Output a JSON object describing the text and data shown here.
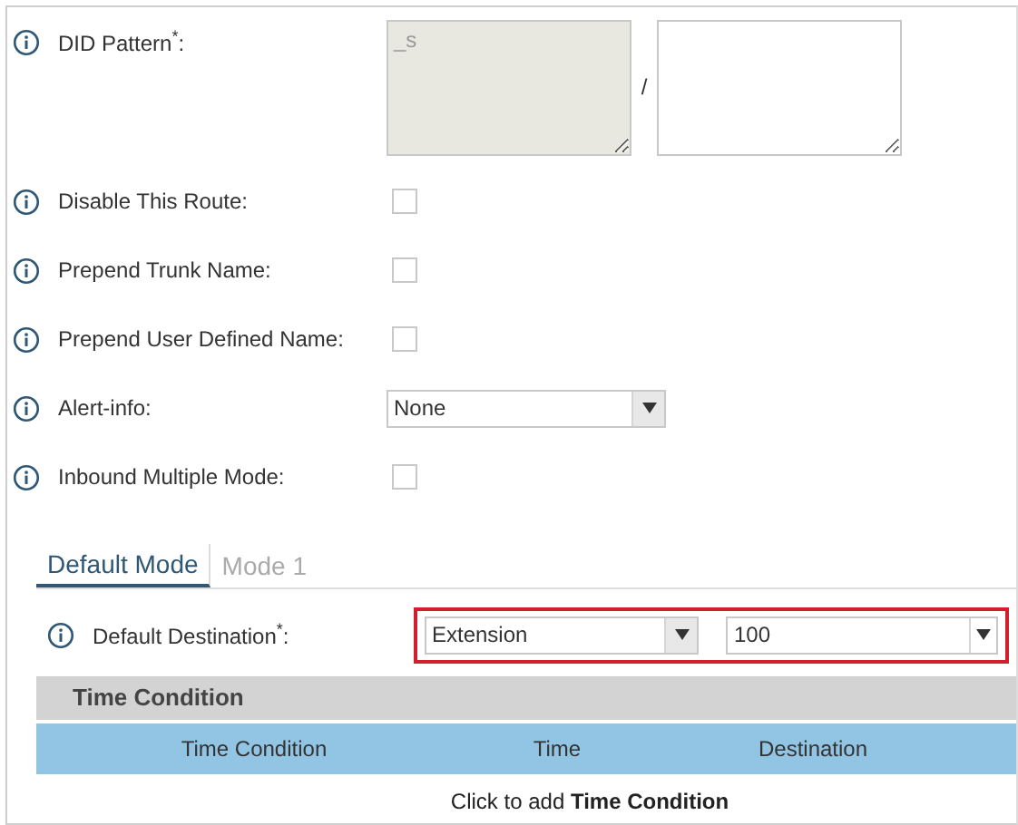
{
  "fields": [
    {
      "kind": "pattern",
      "label": "DID Pattern$^{*}$:",
      "placeholder": "_s",
      "disabled": true
    },
    {
      "kind": "checkbox",
      "label": "Disable This Route:",
      "checked": false
    },
    {
      "kind": "checkbox",
      "label": "Prepend Trunk Name:",
      "checked": false
    },
    {
      "kind": "checkbox",
      "label": "Prepend User Defined Name:",
      "checked": false
    },
    {
      "kind": "select",
      "label": "Alert-info:",
      "value": "None"
    },
    {
      "kind": "checkbox",
      "label": "Inbound Multiple Mode:",
      "checked": false
    }
  ],
  "separator": "/",
  "tabs": [
    {
      "label": "Default Mode",
      "selected": true
    },
    {
      "label": "Mode 1",
      "selected": false
    }
  ],
  "default_destination": {
    "label": "Default Destination$^{*}$:",
    "type": "Extension",
    "value": "100"
  },
  "time_condition": {
    "title": "Time Condition",
    "columns": [
      "Time Condition",
      "Time",
      "Destination"
    ],
    "add_text": "Click to add **Time Condition**"
  }
}
